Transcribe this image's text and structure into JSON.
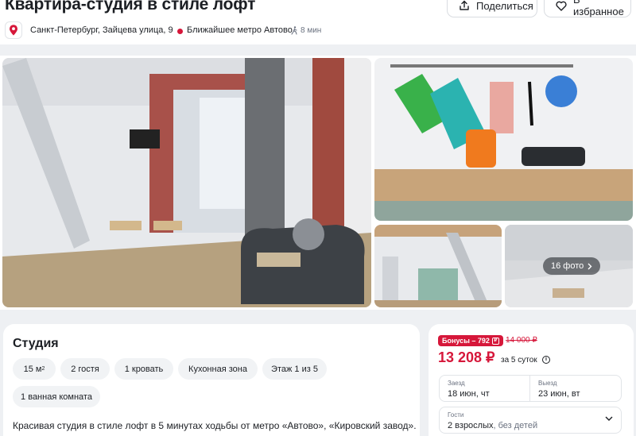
{
  "header": {
    "title": "Квартира-студия в стиле лофт",
    "share_label": "Поделиться",
    "favorite_label": "В избранное"
  },
  "location": {
    "address": "Санкт-Петербург, Зайцева улица, 9",
    "metro": "Ближайшее метро Автово",
    "walk_time": "8 мин"
  },
  "gallery": {
    "more_photos": "16 фото"
  },
  "room": {
    "type": "Студия",
    "features": [
      "15 м",
      "2 гостя",
      "1 кровать",
      "Кухонная зона",
      "Этаж 1 из 5",
      "1 ванная комната"
    ],
    "area_unit_sup": "2",
    "description": "Красивая студия в стиле лофт в 5 минутах ходьбы от метро «Автово», «Кировский завод»."
  },
  "booking": {
    "bonus": "Бонусы – 792",
    "old_price": "14 000 ₽",
    "price": "13 208 ₽",
    "period": "за 5 суток",
    "checkin_label": "Заезд",
    "checkin_value": "18 июн, чт",
    "checkout_label": "Выезд",
    "checkout_value": "23 июн, вт",
    "guests_label": "Гости",
    "guests_value": "2 взрослых",
    "guests_children": ", без детей"
  },
  "colors": {
    "accent": "#d6173a",
    "page_bg": "#eef0f3",
    "chip_bg": "#f1f3f5"
  }
}
